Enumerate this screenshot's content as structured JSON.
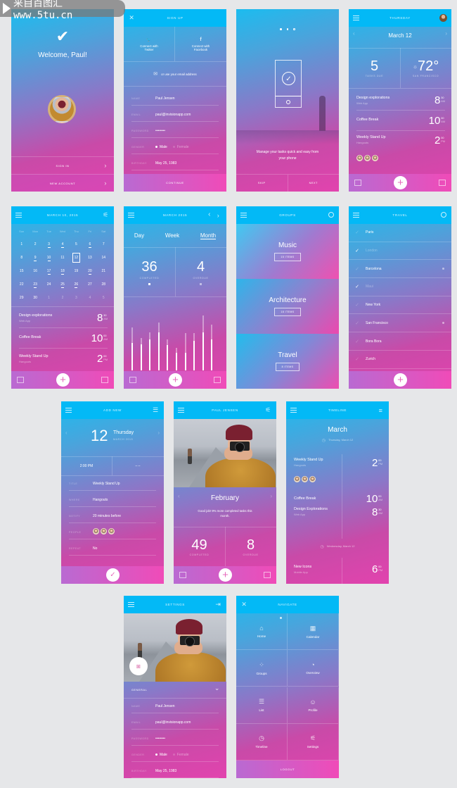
{
  "watermark": "来自百图汇 www.5tu.cn",
  "colors": {
    "header": "#03b9f6",
    "gradient_top": "#1cbcef",
    "gradient_bottom": "#e243ae",
    "accent_pink": "#f04bb8"
  },
  "screens": {
    "welcome": {
      "title": "Welcome, Paul!",
      "sign_in": "SIGN IN",
      "new_account": "NEW ACCOUNT"
    },
    "signup": {
      "header": "SIGN UP",
      "twitter": "Connect with Twitter",
      "facebook": "Connect with Facebook",
      "email_hint": "or use your email address",
      "name_label": "NAME",
      "name": "Paul Jensen",
      "email_label": "EMAIL",
      "email": "paul@invisionapp.com",
      "password_label": "PASSWORD",
      "password": "••••••••",
      "gender_label": "GENDER",
      "gender_male": "Male",
      "gender_female": "Female",
      "gender_selected": "Male",
      "birthday_label": "BIRTHDAY",
      "birthday": "May 25, 1983",
      "continue": "CONTINUE"
    },
    "onboarding": {
      "page": 1,
      "pages": 3,
      "text": "Manage your tasks quick and easy from your phone",
      "skip": "SKIP",
      "next": "NEXT"
    },
    "today": {
      "header": "THURSDAY",
      "date": "March 12",
      "tasks_due": "5",
      "tasks_label": "TASKS DUE",
      "temperature": "72°",
      "city": "SAN FRANCISCO",
      "events": [
        {
          "title": "Design explorations",
          "sub": "Web App",
          "hour": "8",
          "min": "30",
          "ampm": "AM"
        },
        {
          "title": "Coffee Break",
          "sub": "",
          "hour": "10",
          "min": "00",
          "ampm": "AM"
        },
        {
          "title": "Weekly Stand Up",
          "sub": "Hangouts",
          "hour": "2",
          "min": "00",
          "ampm": "PM"
        }
      ]
    },
    "calendar": {
      "header": "MARCH 10, 2015",
      "weekdays": [
        "Sun",
        "Mon",
        "Tue",
        "Wed",
        "Thu",
        "Fri",
        "Sat"
      ],
      "days": [
        {
          "n": "1"
        },
        {
          "n": "2"
        },
        {
          "n": "3",
          "has_tasks": true
        },
        {
          "n": "4",
          "has_tasks": true
        },
        {
          "n": "5"
        },
        {
          "n": "6",
          "has_tasks": true
        },
        {
          "n": "7"
        },
        {
          "n": "8"
        },
        {
          "n": "9",
          "has_tasks": true
        },
        {
          "n": "10",
          "has_tasks": true
        },
        {
          "n": "11"
        },
        {
          "n": "12",
          "selected": true,
          "has_tasks": true
        },
        {
          "n": "13"
        },
        {
          "n": "14"
        },
        {
          "n": "15"
        },
        {
          "n": "16"
        },
        {
          "n": "17",
          "has_tasks": true
        },
        {
          "n": "18",
          "has_tasks": true
        },
        {
          "n": "19"
        },
        {
          "n": "20",
          "has_tasks": true
        },
        {
          "n": "21"
        },
        {
          "n": "22"
        },
        {
          "n": "23",
          "has_tasks": true
        },
        {
          "n": "24"
        },
        {
          "n": "25",
          "has_tasks": true
        },
        {
          "n": "26",
          "has_tasks": true
        },
        {
          "n": "27"
        },
        {
          "n": "28"
        },
        {
          "n": "29"
        },
        {
          "n": "30"
        },
        {
          "n": "1",
          "other_month": true
        },
        {
          "n": "2",
          "other_month": true
        },
        {
          "n": "3",
          "other_month": true
        },
        {
          "n": "4",
          "other_month": true
        },
        {
          "n": "5",
          "other_month": true
        }
      ],
      "events": [
        {
          "title": "Design explorations",
          "sub": "Web App",
          "hour": "8",
          "min": "30",
          "ampm": "AM"
        },
        {
          "title": "Coffee Break",
          "sub": "",
          "hour": "10",
          "min": "00",
          "ampm": "AM"
        },
        {
          "title": "Weekly Stand Up",
          "sub": "Hangouts",
          "hour": "2",
          "min": "00",
          "ampm": "PM"
        }
      ]
    },
    "stats": {
      "header": "MARCH 2015",
      "tabs": [
        "Day",
        "Week",
        "Month"
      ],
      "active_tab": "Month",
      "completed": "36",
      "completed_label": "COMPLETED",
      "overdue": "4",
      "overdue_label": "OVERDUE",
      "chart": {
        "type": "bar",
        "categories": [
          "1",
          "3",
          "6",
          "9",
          "12",
          "15",
          "18",
          "21",
          "24",
          "27"
        ],
        "completed": [
          11.5,
          11,
          13,
          16,
          10.5,
          7.5,
          7.5,
          12.5,
          16,
          13
        ],
        "total": [
          18,
          13.5,
          16,
          20,
          13,
          9.5,
          15.5,
          15.5,
          23,
          19
        ]
      }
    },
    "groups": {
      "header": "GROUPS",
      "items": [
        {
          "title": "Music",
          "count": "15 ITEMS"
        },
        {
          "title": "Architecture",
          "count": "18 ITEMS"
        },
        {
          "title": "Travel",
          "count": "8 ITEMS"
        }
      ]
    },
    "travel": {
      "header": "TRAVEL",
      "items": [
        {
          "name": "Paris"
        },
        {
          "name": "London",
          "checked": true
        },
        {
          "name": "Barcelona",
          "dot": true
        },
        {
          "name": "Maui",
          "checked": true
        },
        {
          "name": "New York"
        },
        {
          "name": "San Francisco",
          "dot": true
        },
        {
          "name": "Bora Bora"
        },
        {
          "name": "Zurich"
        }
      ]
    },
    "add_new": {
      "header": "ADD NEW",
      "day": "12",
      "weekday": "Thursday",
      "month": "MARCH 2015",
      "time": "2:00 PM",
      "end_time": "– –",
      "title_label": "TITLE",
      "title": "Weekly Stand Up",
      "where_label": "WHERE",
      "where": "Hangouts",
      "notify_label": "NOTIFY",
      "notify": "20 minutes before",
      "people_label": "PEOPLE",
      "repeat_label": "REPEAT",
      "repeat": "No"
    },
    "profile": {
      "header": "PAUL JENSEN",
      "month": "February",
      "message": "Good job! 9% more completed tasks this month.",
      "completed": "49",
      "completed_label": "COMPLETED",
      "overdue": "8",
      "overdue_label": "OVERDUE"
    },
    "timeline": {
      "header": "TIMELINE",
      "month": "March",
      "day1": "Thursday, March 12",
      "day2": "Wednesday, March 12",
      "events": [
        {
          "title": "Weekly Stand Up",
          "sub": "Hangouts",
          "hour": "2",
          "min": "00",
          "ampm": "PM"
        },
        {
          "title": "Coffee Break",
          "sub": "",
          "hour": "10",
          "min": "00",
          "ampm": "AM"
        },
        {
          "title": "Design Explorations",
          "sub": "Web App",
          "hour": "8",
          "min": "30",
          "ampm": "AM"
        },
        {
          "title": "New Icons",
          "sub": "Mobile App",
          "hour": "6",
          "min": "00",
          "ampm": "PM"
        }
      ]
    },
    "settings": {
      "header": "SETTINGS",
      "section": "GENERAL",
      "name_label": "NAME",
      "name": "Paul Jensen",
      "email_label": "EMAIL",
      "email": "paul@invisionapp.com",
      "password_label": "PASSWORD",
      "password": "••••••••",
      "gender_label": "GENDER",
      "gender_male": "Male",
      "gender_female": "Female",
      "gender_selected": "Male",
      "birthday_label": "BIRTHDAY",
      "birthday": "May 25, 1983"
    },
    "navigate": {
      "header": "NAVIGATE",
      "items": [
        {
          "label": "Home",
          "icon": "home-icon",
          "glyph": "⌂"
        },
        {
          "label": "Calendar",
          "icon": "calendar-icon",
          "glyph": "▦"
        },
        {
          "label": "Groups",
          "icon": "groups-icon",
          "glyph": "⁘"
        },
        {
          "label": "Overview",
          "icon": "pie-chart-icon",
          "glyph": "◔"
        },
        {
          "label": "List",
          "icon": "list-icon",
          "glyph": "☰"
        },
        {
          "label": "Profile",
          "icon": "profile-icon",
          "glyph": "☺"
        },
        {
          "label": "Timeline",
          "icon": "timeline-icon",
          "glyph": "◷"
        },
        {
          "label": "Settings",
          "icon": "sliders-icon",
          "glyph": "⚟"
        }
      ],
      "logout": "LOGOUT"
    }
  }
}
